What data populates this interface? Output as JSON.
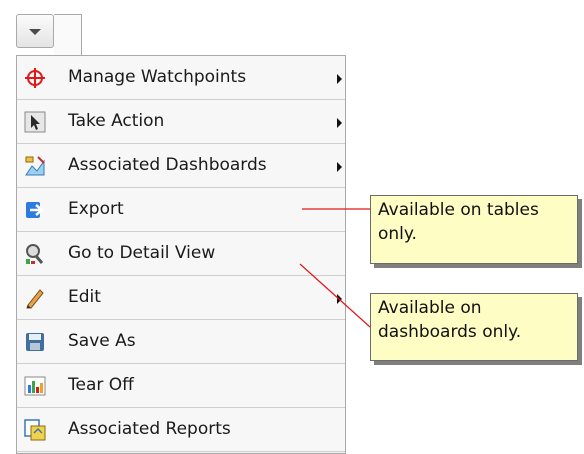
{
  "menu": {
    "items": [
      {
        "label": "Manage Watchpoints",
        "icon": "crosshair-icon",
        "submenu": true
      },
      {
        "label": "Take Action",
        "icon": "cursor-icon",
        "submenu": true
      },
      {
        "label": "Associated Dashboards",
        "icon": "dashboard-icon",
        "submenu": true
      },
      {
        "label": "Export",
        "icon": "export-arrow-icon",
        "submenu": false
      },
      {
        "label": "Go to Detail View",
        "icon": "detail-view-icon",
        "submenu": false
      },
      {
        "label": "Edit",
        "icon": "pencil-icon",
        "submenu": true
      },
      {
        "label": "Save As",
        "icon": "floppy-disk-icon",
        "submenu": false
      },
      {
        "label": "Tear Off",
        "icon": "tear-off-chart-icon",
        "submenu": false
      },
      {
        "label": "Associated Reports",
        "icon": "reports-icon",
        "submenu": false
      }
    ]
  },
  "callouts": {
    "tables": "Available on tables only.",
    "dashboards": "Available on dashboards only."
  },
  "colors": {
    "callout_fill": "#fefdc4",
    "connector_line": "#e01818",
    "export_icon": "#1e6fd9",
    "crosshair_icon": "#e01818"
  }
}
